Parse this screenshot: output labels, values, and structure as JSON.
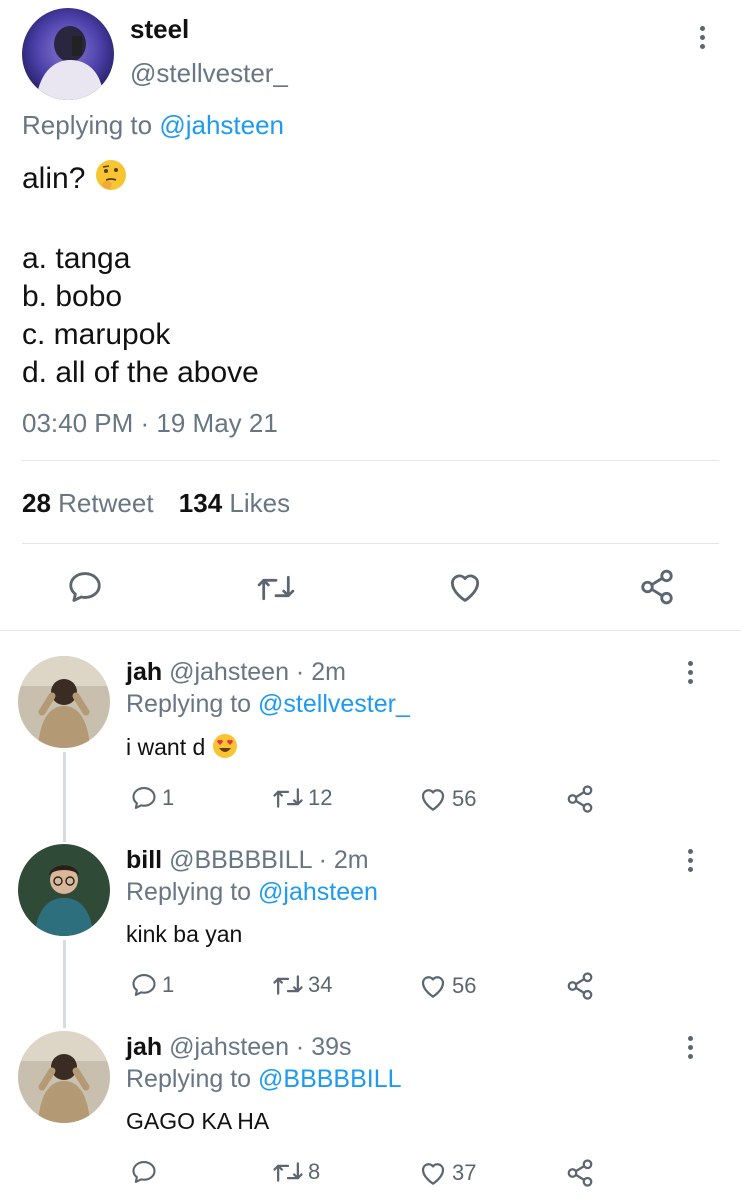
{
  "main_tweet": {
    "display_name": "steel",
    "handle": "@stellvester_",
    "replying_prefix": "Replying to",
    "replying_to": "@jahsteen",
    "question": "alin?",
    "options": [
      "a. tanga",
      "b. bobo",
      "c. marupok",
      "d. all of the above"
    ],
    "timestamp": "03:40 PM · 19 May 21",
    "retweet_count": "28",
    "retweet_label": "Retweet",
    "likes_count": "134",
    "likes_label": "Likes",
    "icons": [
      "reply-icon",
      "retweet-icon",
      "like-icon",
      "share-icon",
      "more-icon"
    ]
  },
  "replies": [
    {
      "name": "jah",
      "handle_time": "@jahsteen · 2m",
      "replying_prefix": "Replying to",
      "replying_to": "@stellvester_",
      "text": "i want d",
      "reply_count": "1",
      "retweet_count": "12",
      "like_count": "56"
    },
    {
      "name": "bill",
      "handle_time": "@BBBBBILL · 2m",
      "replying_prefix": "Replying to",
      "replying_to": "@jahsteen",
      "text": "kink ba yan",
      "reply_count": "1",
      "retweet_count": "34",
      "like_count": "56"
    },
    {
      "name": "jah",
      "handle_time": "@jahsteen · 39s",
      "replying_prefix": "Replying to",
      "replying_to": "@BBBBBILL",
      "text": "GAGO KA HA",
      "reply_count": "",
      "retweet_count": "8",
      "like_count": "37"
    }
  ],
  "colors": {
    "link": "#1d9bf0",
    "muted": "#687684",
    "divider": "#e3e6e9"
  }
}
